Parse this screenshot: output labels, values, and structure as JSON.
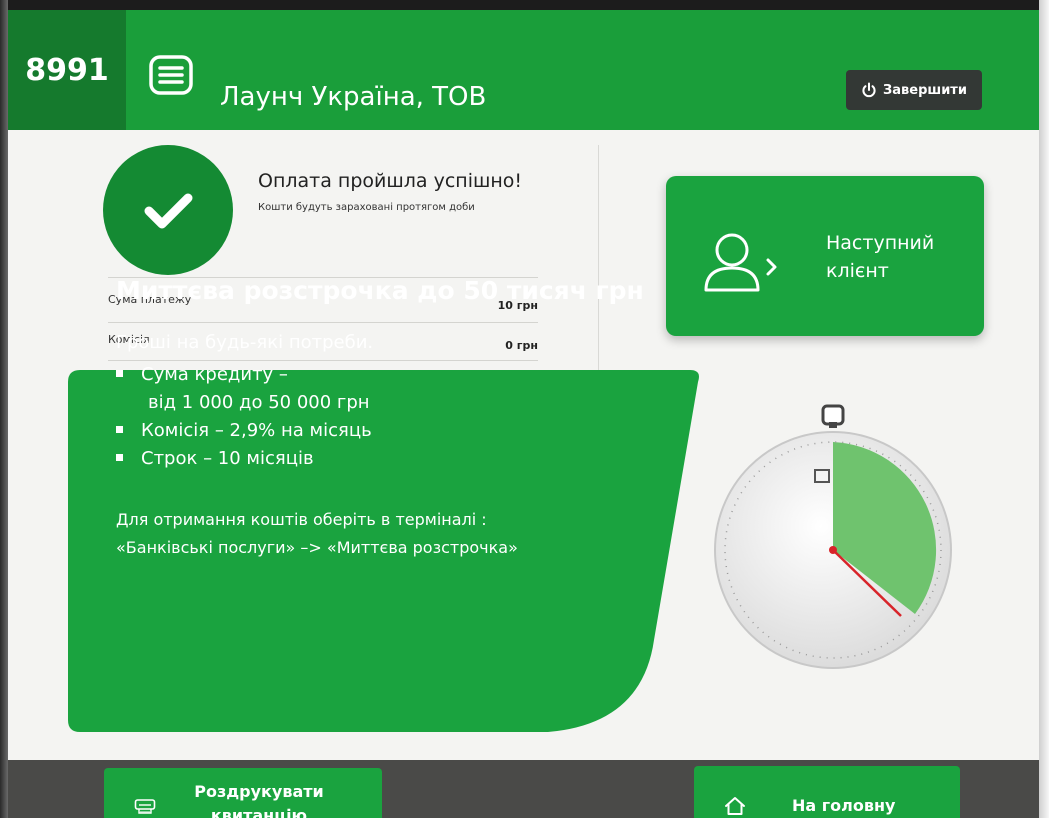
{
  "header": {
    "terminal_id": "8991",
    "merchant_name": "Лаунч Україна, ТОВ",
    "exit_label": "Завершити"
  },
  "payment": {
    "title": "Оплата пройшла успішно!",
    "subtitle": "Кошти будуть зараховані протягом доби",
    "rows": [
      {
        "label": "Сума платежу",
        "value": "10 грн"
      },
      {
        "label": "Комісія",
        "value": "0 грн"
      }
    ]
  },
  "next_client": {
    "label_line1": "Наступний",
    "label_line2": "клієнт"
  },
  "promo": {
    "title": "Миттєва розстрочка до 50 тисяч грн",
    "intro": "Гроші на будь-які потреби.",
    "bullets": [
      {
        "line1": "Сума кредиту –",
        "line2": "від 1 000 до 50 000 грн"
      },
      {
        "line1": "Комісія – 2,9% на місяць"
      },
      {
        "line1": "Строк – 10 місяців"
      }
    ],
    "note_line1": "Для отримання коштів оберіть в терміналі :",
    "note_line2": "«Банківські послуги» –> «Миттєва розстрочка»"
  },
  "footer": {
    "print_line1": "Роздрукувати",
    "print_line2": "квитанцію",
    "home_label": "На головну"
  },
  "colors": {
    "brand_green": "#1a9e3a",
    "dark_green": "#148a33",
    "exit_bg": "#333835"
  },
  "icons": {
    "menu": "menu-icon",
    "exit": "power-icon",
    "success": "checkmark-icon",
    "next_client": "user-arrow-icon",
    "print": "printer-icon",
    "home": "home-icon",
    "timer": "clock-icon"
  }
}
